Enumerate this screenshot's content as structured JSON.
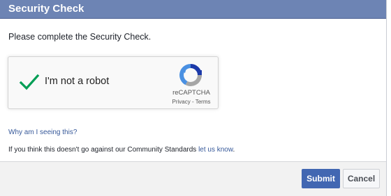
{
  "dialog": {
    "title": "Security Check",
    "prompt": "Please complete the Security Check."
  },
  "captcha": {
    "checkbox_label": "I'm not a robot",
    "checked": true,
    "brand": "reCAPTCHA",
    "privacy_link": "Privacy",
    "separator": " - ",
    "terms_link": "Terms"
  },
  "help": {
    "why_link": "Why am I seeing this?",
    "info_text": "If you think this doesn't go against our Community Standards ",
    "info_link": "let us know",
    "info_end": "."
  },
  "footer": {
    "submit_label": "Submit",
    "cancel_label": "Cancel"
  },
  "colors": {
    "header_bg": "#6d84b4",
    "submit_bg": "#4267b2",
    "link": "#365899",
    "check": "#009e55"
  }
}
